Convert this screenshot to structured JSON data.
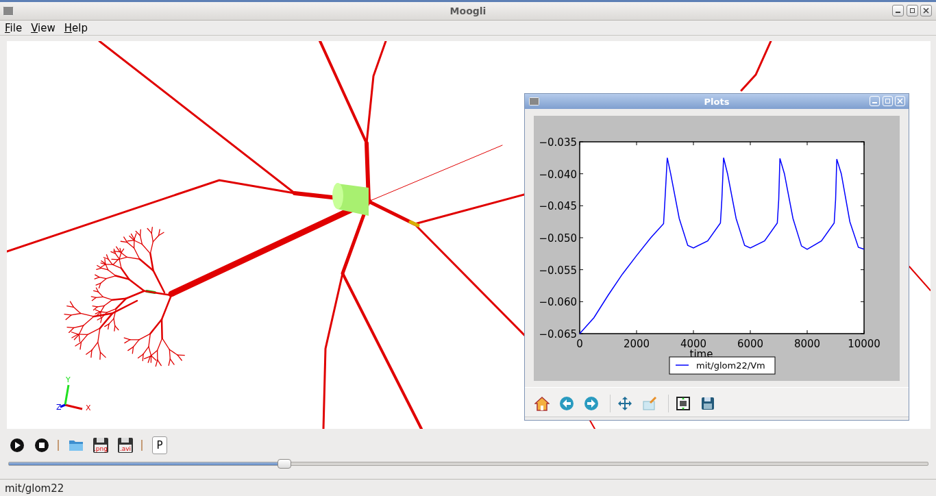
{
  "window": {
    "title": "Moogli"
  },
  "menu": [
    {
      "label": "File"
    },
    {
      "label": "View"
    },
    {
      "label": "Help"
    }
  ],
  "viewport": {
    "axes": [
      {
        "kind": "x",
        "label": "X"
      },
      {
        "kind": "y",
        "label": "Y"
      },
      {
        "kind": "z",
        "label": "Z"
      }
    ]
  },
  "plots_window": {
    "title": "Plots",
    "chart_data": {
      "type": "line",
      "xlabel": "time",
      "x": [
        0,
        500,
        1000,
        1500,
        2000,
        2500,
        2950,
        3000,
        3080,
        3200,
        3500,
        3800,
        4000,
        4500,
        4950,
        5000,
        5060,
        5200,
        5500,
        5800,
        6000,
        6500,
        6950,
        7000,
        7040,
        7200,
        7500,
        7800,
        8000,
        8500,
        8950,
        9000,
        9040,
        9200,
        9500,
        9800,
        10000
      ],
      "series": [
        {
          "name": "mit/glom22/Vm",
          "color": "#0000ff",
          "values": [
            -0.065,
            -0.0625,
            -0.059,
            -0.0557,
            -0.0528,
            -0.05,
            -0.0478,
            -0.044,
            -0.0375,
            -0.04,
            -0.047,
            -0.0512,
            -0.0516,
            -0.0505,
            -0.0477,
            -0.044,
            -0.0375,
            -0.04,
            -0.047,
            -0.0512,
            -0.0516,
            -0.0505,
            -0.0477,
            -0.044,
            -0.0376,
            -0.04,
            -0.047,
            -0.0513,
            -0.0518,
            -0.0505,
            -0.0477,
            -0.044,
            -0.0377,
            -0.04,
            -0.0475,
            -0.0515,
            -0.0518
          ]
        }
      ],
      "xlim": [
        0,
        10000
      ],
      "ylim": [
        -0.065,
        -0.035
      ],
      "xticks": [
        0,
        2000,
        4000,
        6000,
        8000,
        10000
      ],
      "yticks": [
        {
          "value": -0.035,
          "label": "−0.035"
        },
        {
          "value": -0.04,
          "label": "−0.040"
        },
        {
          "value": -0.045,
          "label": "−0.045"
        },
        {
          "value": -0.05,
          "label": "−0.050"
        },
        {
          "value": -0.055,
          "label": "−0.055"
        },
        {
          "value": -0.06,
          "label": "−0.060"
        },
        {
          "value": -0.065,
          "label": "−0.065"
        }
      ]
    },
    "toolbar": [
      {
        "kind": "home"
      },
      {
        "kind": "back"
      },
      {
        "kind": "forward"
      },
      {
        "kind": "separator"
      },
      {
        "kind": "pan"
      },
      {
        "kind": "zoom"
      },
      {
        "kind": "separator"
      },
      {
        "kind": "subplots"
      },
      {
        "kind": "save"
      }
    ]
  },
  "toolbar": [
    {
      "kind": "play"
    },
    {
      "kind": "stop"
    },
    {
      "kind": "separator"
    },
    {
      "kind": "open"
    },
    {
      "kind": "save",
      "label": ".png"
    },
    {
      "kind": "save",
      "label": ".avi"
    },
    {
      "kind": "separator"
    },
    {
      "kind": "plot",
      "label": "P"
    }
  ],
  "timeline": {
    "level": 0.3
  },
  "status_bar": "mit/glom22"
}
